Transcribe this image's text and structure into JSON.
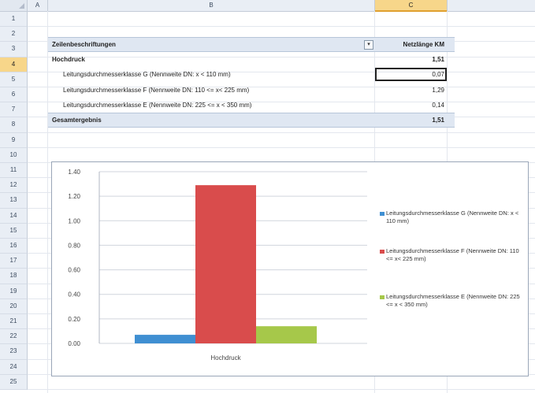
{
  "spreadsheet": {
    "columns": [
      {
        "key": "A",
        "label": "A",
        "selected": false
      },
      {
        "key": "B",
        "label": "B",
        "selected": false
      },
      {
        "key": "C",
        "label": "C",
        "selected": true
      }
    ],
    "rows": [
      "1",
      "2",
      "3",
      "4",
      "5",
      "6",
      "7",
      "8",
      "9",
      "10",
      "11",
      "12",
      "13",
      "14",
      "15",
      "16",
      "17",
      "18",
      "19",
      "20",
      "21",
      "22",
      "23",
      "24",
      "25"
    ],
    "selected_row": "4"
  },
  "pivot": {
    "row_labels_header": "Zeilenbeschriftungen",
    "value_header": "Netzlänge KM",
    "filter_icon": "filter-dropdown-icon",
    "group": {
      "label": "Hochdruck",
      "value": "1,51"
    },
    "items": [
      {
        "label": "Leitungsdurchmesserklasse G (Nennweite DN: x < 110 mm)",
        "value": "0,07"
      },
      {
        "label": "Leitungsdurchmesserklasse F (Nennweite DN: 110 <= x< 225 mm)",
        "value": "1,29"
      },
      {
        "label": "Leitungsdurchmesserklasse E (Nennweite DN: 225 <= x < 350 mm)",
        "value": "0,14"
      }
    ],
    "total": {
      "label": "Gesamtergebnis",
      "value": "1,51"
    }
  },
  "colors": {
    "series_g": "#3f8fd2",
    "series_f": "#d94c4c",
    "series_e": "#a6c84a",
    "active_cell": "#222222",
    "selected_header": "#f7d68a"
  },
  "chart_data": {
    "type": "bar",
    "categories": [
      "Hochdruck"
    ],
    "series": [
      {
        "name": "Leitungsdurchmesserklasse G (Nennweite DN: x < 110 mm)",
        "values": [
          0.07
        ],
        "color": "#3f8fd2"
      },
      {
        "name": "Leitungsdurchmesserklasse F (Nennweite DN: 110 <= x< 225 mm)",
        "values": [
          1.29
        ],
        "color": "#d94c4c"
      },
      {
        "name": "Leitungsdurchmesserklasse E (Nennweite DN: 225 <= x < 350 mm)",
        "values": [
          0.14
        ],
        "color": "#a6c84a"
      }
    ],
    "yticks": [
      "0.00",
      "0.20",
      "0.40",
      "0.60",
      "0.80",
      "1.00",
      "1.20",
      "1.40"
    ],
    "ylim": [
      0,
      1.4
    ],
    "grid": true,
    "legend_position": "right",
    "title": "",
    "xlabel": "",
    "ylabel": ""
  }
}
